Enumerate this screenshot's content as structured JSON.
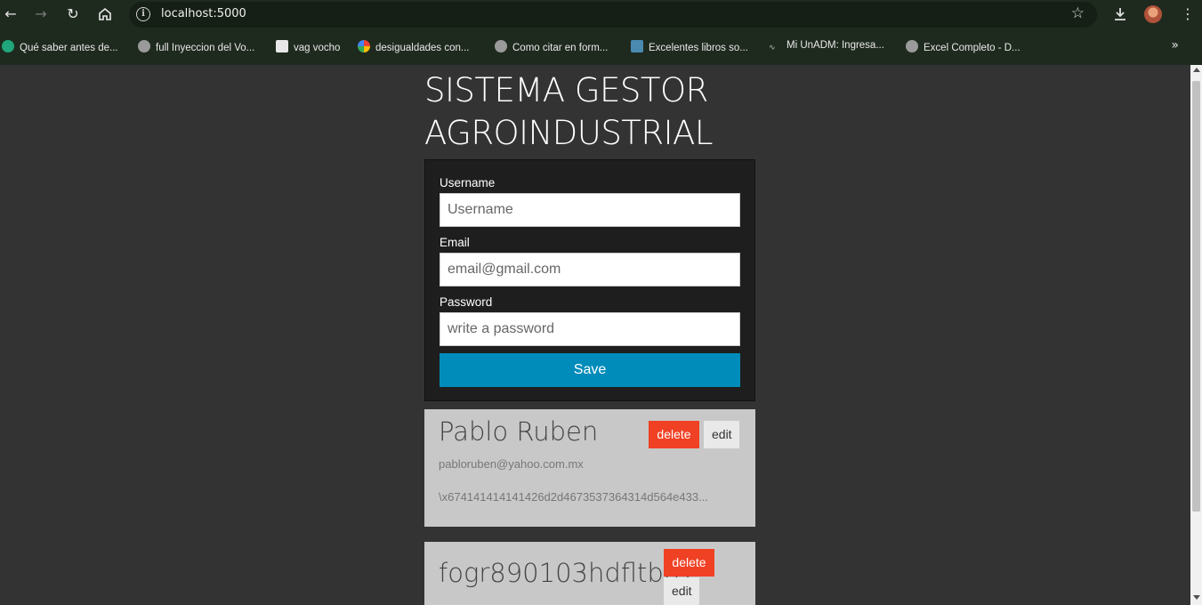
{
  "browser": {
    "url": "localhost:5000",
    "bookmarks": [
      {
        "label": "Qué saber antes de...",
        "icon": "vinted-icon"
      },
      {
        "label": "full Inyeccion del Vo...",
        "icon": "globe-icon"
      },
      {
        "label": "vag vocho",
        "icon": "page-icon"
      },
      {
        "label": "desigualdades con...",
        "icon": "google-icon"
      },
      {
        "label": "Como citar en form...",
        "icon": "globe-icon"
      },
      {
        "label": "Excelentes libros so...",
        "icon": "image-icon"
      },
      {
        "label": "Mi UnADM: Ingresa...",
        "icon": "unadm-icon"
      },
      {
        "label": "Excel Completo - D...",
        "icon": "globe-icon"
      }
    ]
  },
  "app": {
    "title_line1": "SISTEMA GESTOR",
    "title_line2": "AGROINDUSTRIAL"
  },
  "form": {
    "username_label": "Username",
    "username_placeholder": "Username",
    "email_label": "Email",
    "email_placeholder": "email@gmail.com",
    "password_label": "Password",
    "password_placeholder": "write a password",
    "save_label": "Save"
  },
  "users": [
    {
      "name": "Pablo Ruben",
      "email": "pabloruben@yahoo.com.mx",
      "password_hash": "\\x674141414141426d2d4673537364314d564e433...",
      "delete_label": "delete",
      "edit_label": "edit"
    },
    {
      "name": "fogr890103hdfltb07",
      "delete_label": "delete",
      "edit_label": "edit"
    }
  ],
  "colors": {
    "save": "#008cba",
    "delete": "#f04124",
    "page_bg": "#333333",
    "card_bg": "#c8c8c8",
    "form_bg": "#1e1e1e"
  }
}
